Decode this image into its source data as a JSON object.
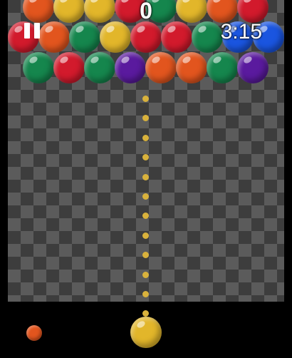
{
  "colors": {
    "red": "#d21a2c",
    "orange": "#e2551e",
    "yellow": "#e2b62a",
    "green": "#15864d",
    "purple": "#5a1a9e",
    "blue": "#1a55e0",
    "board_dark": "#3d3d3d",
    "board_light": "#5b5b5b",
    "aim_dot": "#d9b23c"
  },
  "hud": {
    "score": "0",
    "timer": "3:15",
    "pause_icon": "pause-icon"
  },
  "rows": [
    [
      "orange",
      "yellow",
      "yellow",
      "red",
      "green",
      "yellow",
      "orange",
      "red"
    ],
    [
      "red",
      "orange",
      "green",
      "yellow",
      "red",
      "red",
      "green",
      "blue",
      "blue"
    ],
    [
      "green",
      "red",
      "green",
      "purple",
      "orange",
      "orange",
      "green",
      "purple"
    ]
  ],
  "next_bubble": "orange",
  "shooter_bubble": "yellow"
}
